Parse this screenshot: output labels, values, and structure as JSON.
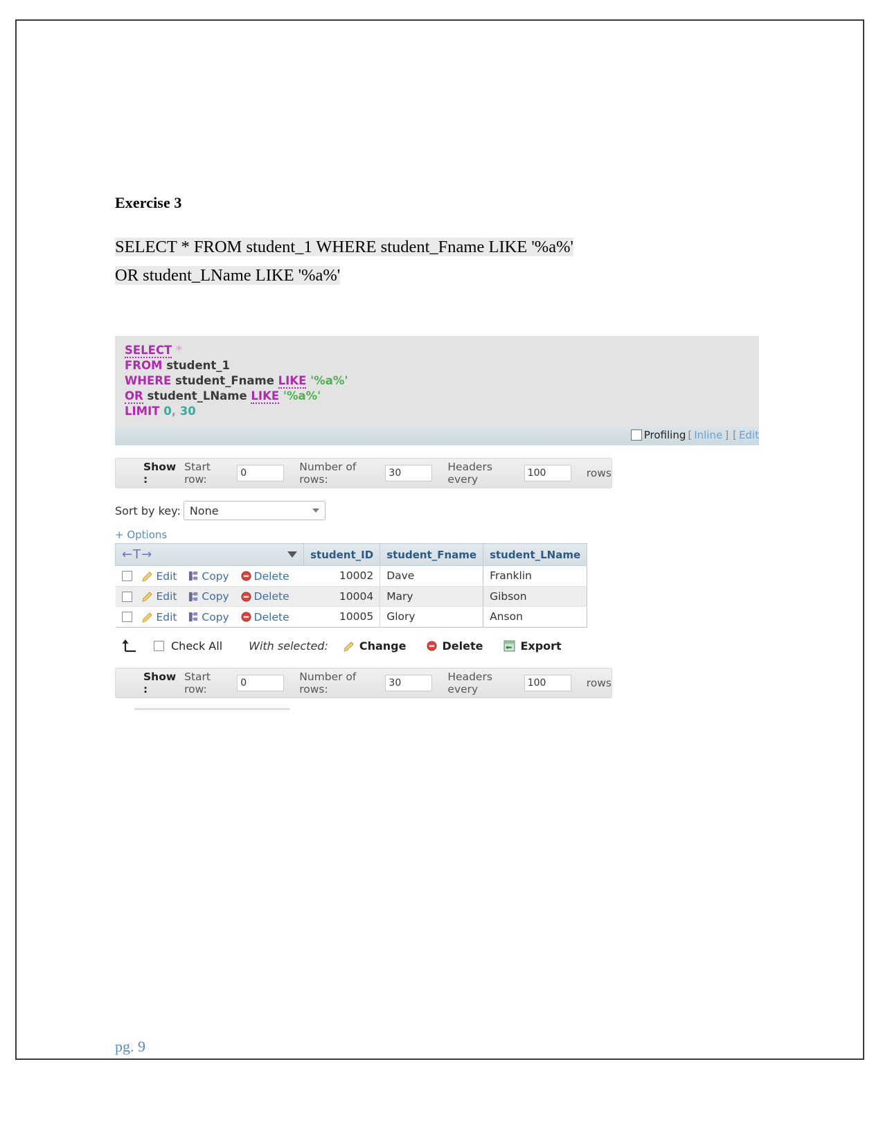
{
  "document": {
    "exercise_title": "Exercise 3",
    "query_line_1_part_1": "SELECT * FROM ",
    "query_line_1_part_2": "student_1",
    "query_line_1_part_3": " WHERE student_Fname LIKE ",
    "query_line_1_part_4": "'%a%'",
    "query_line_2": "OR student_LName LIKE '%a%'",
    "page_number": "pg. 9"
  },
  "query_box": {
    "line1_kw": "SELECT",
    "line1_star": "*",
    "line2_kw": "FROM",
    "line2_obj": "student_1",
    "line3_kw": "WHERE",
    "line3_col": "student_Fname",
    "line3_kw2": "LIKE",
    "line3_str": "'%a%'",
    "line4_kw": "OR",
    "line4_col": "student_LName",
    "line4_kw2": "LIKE",
    "line4_str": "'%a%'",
    "line5_kw": "LIMIT",
    "line5_num1": "0",
    "line5_comma": ",",
    "line5_num2": "30"
  },
  "profiling": {
    "label": "Profiling",
    "bracket_open": "[",
    "inline_label": "Inline",
    "bracket_close": "]",
    "bracket_open_2": "[",
    "edit_label": "Edit"
  },
  "show_bar": {
    "show_label": "Show :",
    "start_row_label": "Start row:",
    "start_row_value": "0",
    "number_of_rows_label": "Number of rows:",
    "number_of_rows_value": "30",
    "headers_every_label": "Headers every",
    "headers_every_value": "100",
    "rows_label": "rows"
  },
  "sort": {
    "label": "Sort by key:",
    "selected": "None"
  },
  "options_link": "+ Options",
  "table": {
    "control_header_arrows": "←T→",
    "columns": [
      "student_ID",
      "student_Fname",
      "student_LName"
    ],
    "row_actions": {
      "edit": "Edit",
      "copy": "Copy",
      "delete": "Delete"
    },
    "rows": [
      {
        "student_ID": "10002",
        "student_Fname": "Dave",
        "student_LName": "Franklin"
      },
      {
        "student_ID": "10004",
        "student_Fname": "Mary",
        "student_LName": "Gibson"
      },
      {
        "student_ID": "10005",
        "student_Fname": "Glory",
        "student_LName": "Anson"
      }
    ]
  },
  "with_selected": {
    "check_all": "Check All",
    "label": "With selected:",
    "change": "Change",
    "delete": "Delete",
    "export": "Export"
  },
  "colors": {
    "keyword": "#b02ab0",
    "string": "#4caf50",
    "number": "#3aa9a0",
    "link": "#3a6ea5",
    "header_text": "#2b5a86",
    "page_number": "#5a8bbd"
  }
}
